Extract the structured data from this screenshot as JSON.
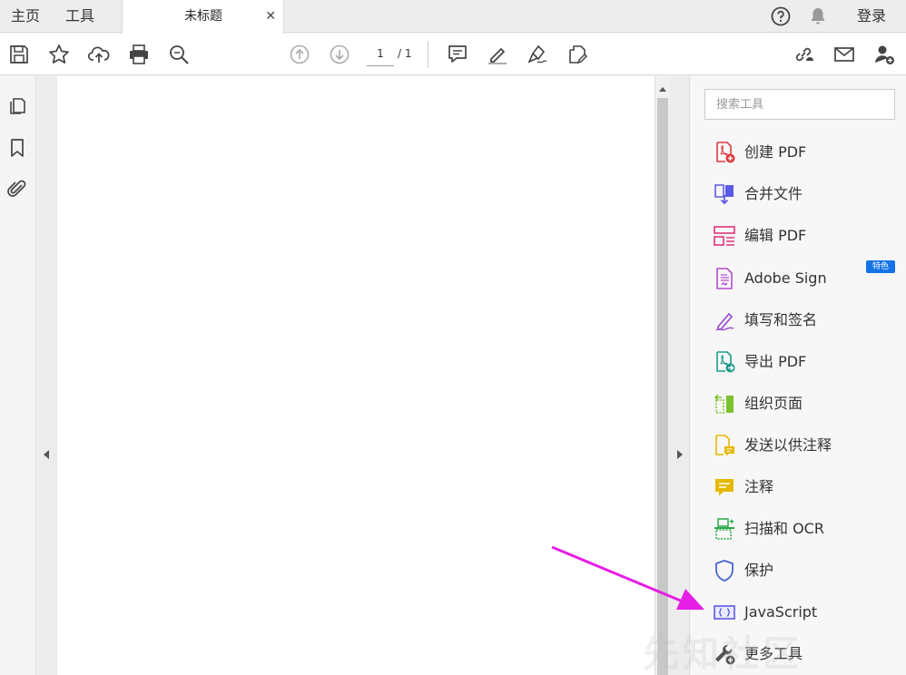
{
  "tabbar": {
    "home_label": "主页",
    "tools_label": "工具",
    "doc_tab_title": "未标题",
    "close_glyph": "✕",
    "login_label": "登录"
  },
  "toolbar": {
    "page_current": "1",
    "page_total": "/ 1"
  },
  "tools_panel": {
    "search_placeholder": "搜索工具",
    "featured_badge": "特色",
    "items": [
      {
        "label": "创建 PDF",
        "icon": "create-pdf-icon",
        "color": "#e03a3e"
      },
      {
        "label": "合并文件",
        "icon": "combine-files-icon",
        "color": "#5a5ae6"
      },
      {
        "label": "编辑 PDF",
        "icon": "edit-pdf-icon",
        "color": "#e0337a"
      },
      {
        "label": "Adobe Sign",
        "icon": "adobe-sign-icon",
        "color": "#b44ccd"
      },
      {
        "label": "填写和签名",
        "icon": "fill-sign-icon",
        "color": "#9c4fd6"
      },
      {
        "label": "导出 PDF",
        "icon": "export-pdf-icon",
        "color": "#1a9b8b"
      },
      {
        "label": "组织页面",
        "icon": "organize-pages-icon",
        "color": "#7cc22f"
      },
      {
        "label": "发送以供注释",
        "icon": "send-comment-icon",
        "color": "#e6b800"
      },
      {
        "label": "注释",
        "icon": "comment-icon",
        "color": "#e6b800"
      },
      {
        "label": "扫描和 OCR",
        "icon": "scan-ocr-icon",
        "color": "#2ea84a"
      },
      {
        "label": "保护",
        "icon": "protect-icon",
        "color": "#4a63d6"
      },
      {
        "label": "JavaScript",
        "icon": "javascript-icon",
        "color": "#5a5ae6"
      },
      {
        "label": "更多工具",
        "icon": "more-tools-icon",
        "color": "#555555"
      }
    ]
  },
  "watermark_text": "先知社区",
  "colors": {
    "accent_blue": "#1473e6",
    "annotation_arrow": "#e61ee6"
  }
}
